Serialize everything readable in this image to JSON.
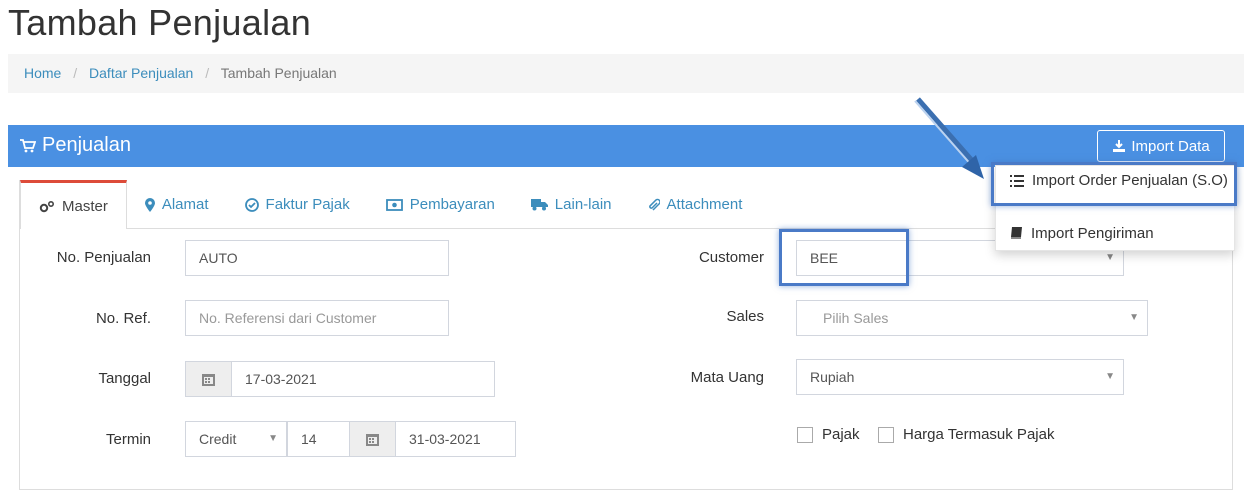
{
  "page_title": "Tambah Penjualan",
  "breadcrumb": {
    "home": "Home",
    "list": "Daftar Penjualan",
    "current": "Tambah Penjualan",
    "separator": "/"
  },
  "panel": {
    "title": "Penjualan",
    "import_button": "Import Data"
  },
  "import_menu": {
    "items": [
      "Import Order Penjualan (S.O)",
      "Import Pengiriman"
    ]
  },
  "tabs": [
    "Master",
    "Alamat",
    "Faktur Pajak",
    "Pembayaran",
    "Lain-lain",
    "Attachment"
  ],
  "form": {
    "no_penjualan": {
      "label": "No. Penjualan",
      "value": "AUTO"
    },
    "no_ref": {
      "label": "No. Ref.",
      "placeholder": "No. Referensi dari Customer"
    },
    "tanggal": {
      "label": "Tanggal",
      "value": "17-03-2021"
    },
    "termin": {
      "label": "Termin",
      "type": "Credit",
      "days": "14",
      "due_date": "31-03-2021"
    },
    "customer": {
      "label": "Customer",
      "value": "BEE"
    },
    "sales": {
      "label": "Sales",
      "placeholder": "Pilih Sales"
    },
    "mata_uang": {
      "label": "Mata Uang",
      "value": "Rupiah"
    },
    "pajak": {
      "label": "Pajak",
      "checked": false
    },
    "harga_termasuk_pajak": {
      "label": "Harga Termasuk Pajak",
      "checked": false
    }
  },
  "colors": {
    "primary": "#4a90e2",
    "tab_active_border": "#dd4b39",
    "link": "#3c8dbc",
    "highlight": "#4a7ac7"
  }
}
